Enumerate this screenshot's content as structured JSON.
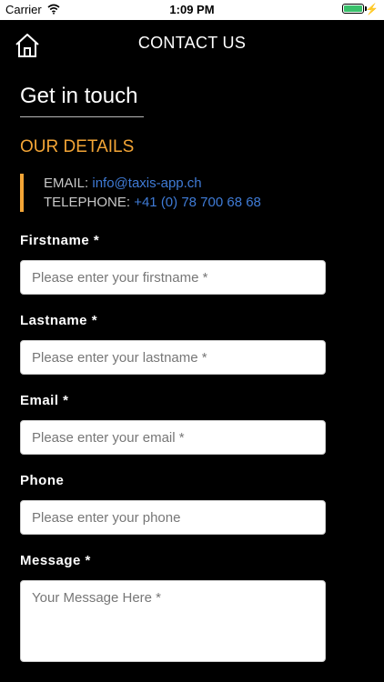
{
  "status_bar": {
    "carrier": "Carrier",
    "time": "1:09 PM",
    "battery_level": 1.0,
    "battery_color": "#39c16b"
  },
  "header": {
    "title": "CONTACT US",
    "home_icon": "home-icon"
  },
  "main": {
    "heading": "Get in touch",
    "details_heading": "OUR DETAILS",
    "accent_color": "#f3a536",
    "link_color": "#3f7bd6",
    "email_label": "EMAIL:",
    "email_value": "info@taxis-app.ch",
    "phone_label": "TELEPHONE:",
    "phone_value": "+41 (0) 78 700 68 68"
  },
  "form": {
    "firstname": {
      "label": "Firstname *",
      "placeholder": "Please enter your firstname *",
      "value": ""
    },
    "lastname": {
      "label": "Lastname *",
      "placeholder": "Please enter your lastname *",
      "value": ""
    },
    "email": {
      "label": "Email *",
      "placeholder": "Please enter your email *",
      "value": ""
    },
    "phone": {
      "label": "Phone",
      "placeholder": "Please enter your phone",
      "value": ""
    },
    "message": {
      "label": "Message *",
      "placeholder": "Your Message Here *",
      "value": ""
    }
  }
}
